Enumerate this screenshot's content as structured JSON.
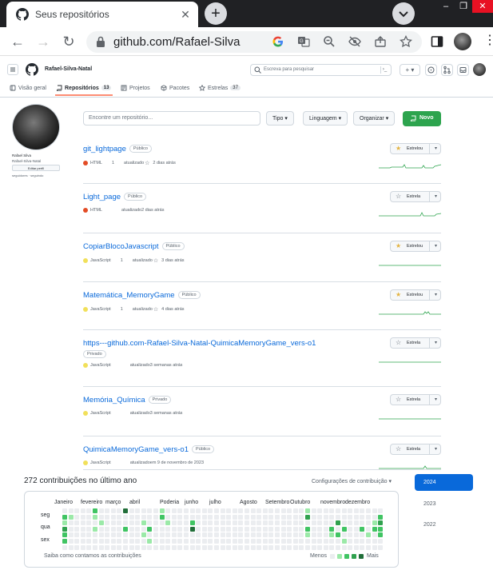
{
  "browser": {
    "tab_title": "Seus repositórios",
    "url": "github.com/Rafael-Silva"
  },
  "github": {
    "username": "Rafael-Silva-Natal",
    "search_placeholder": "Escreva  para pesquisar",
    "nav": [
      {
        "label": "Visão geral",
        "count": ""
      },
      {
        "label": "Repositórios",
        "count": "13"
      },
      {
        "label": "Projetos",
        "count": ""
      },
      {
        "label": "Pacotes",
        "count": ""
      },
      {
        "label": "Estrelas",
        "count": "37"
      }
    ],
    "profile": {
      "name": "Rafael Silva",
      "login": "Rafael-Silva-Natal",
      "edit_label": "Editar perfil",
      "followers": "seguidores · seguindo"
    },
    "filters": {
      "search_placeholder": "Encontre um repositório...",
      "type_label": "Tipo",
      "language_label": "Linguagem",
      "sort_label": "Organizar",
      "new_label": "Novo"
    },
    "repos": [
      {
        "name": "git_lightpage",
        "visibility": "Público",
        "language": "HTML",
        "lang_color": "#e34c26",
        "stars": "1",
        "star_icon": true,
        "updated": "atualizado",
        "when": "2 dias atrás",
        "star_label": "Estrelou",
        "starred": true
      },
      {
        "name": "Light_page",
        "visibility": "Público",
        "language": "HTML",
        "lang_color": "#e34c26",
        "stars": "",
        "star_icon": false,
        "updated": "atualizado",
        "when": "2 dias atrás",
        "star_label": "Estrela",
        "starred": false
      },
      {
        "name": "CopiarBlocoJavascript",
        "visibility": "Público",
        "language": "JavaScript",
        "lang_color": "#f1e05a",
        "stars": "1",
        "star_icon": true,
        "updated": "atualizado",
        "when": "3 dias atrás",
        "star_label": "Estrelou",
        "starred": true
      },
      {
        "name": "Matemática_MemoryGame",
        "visibility": "Público",
        "language": "JavaScript",
        "lang_color": "#f1e05a",
        "stars": "1",
        "star_icon": true,
        "updated": "atualizado",
        "when": "4 dias atrás",
        "star_label": "Estrelou",
        "starred": true
      },
      {
        "name": "https---github.com-Rafael-Silva-Natal-QuimicaMemoryGame_vers-o1",
        "visibility": "Privado",
        "language": "JavaScript",
        "lang_color": "#f1e05a",
        "stars": "",
        "star_icon": false,
        "updated": "atualizado",
        "when": "3 semanas atrás",
        "star_label": "Estrela",
        "starred": false
      },
      {
        "name": "Memória_Química",
        "visibility": "Privado",
        "language": "JavaScript",
        "lang_color": "#f1e05a",
        "stars": "",
        "star_icon": false,
        "updated": "atualizado",
        "when": "3 semanas atrás",
        "star_label": "Estrela",
        "starred": false
      },
      {
        "name": "QuimicaMemoryGame_vers-o1",
        "visibility": "Público",
        "language": "JavaScript",
        "lang_color": "#f1e05a",
        "stars": "",
        "star_icon": false,
        "updated": "atualizado",
        "when": "em 9 de novembro de 2023",
        "star_label": "Estrela",
        "starred": false
      }
    ],
    "contributions": {
      "title": "272 contribuições no último ano",
      "settings_label": "Configurações de contribuição",
      "months": [
        "Janeiro",
        "fevereiro",
        "março",
        "abril",
        "Poderia",
        "junho",
        "julho",
        "Agosto",
        "Setembro",
        "Outubro",
        "novembro",
        "dezembro"
      ],
      "days": [
        "seg",
        "qua",
        "sex"
      ],
      "footer_label": "Saiba como contamos as contribuições",
      "less_label": "Menos",
      "more_label": "Mais",
      "years": [
        "2024",
        "2023",
        "2022"
      ]
    }
  }
}
